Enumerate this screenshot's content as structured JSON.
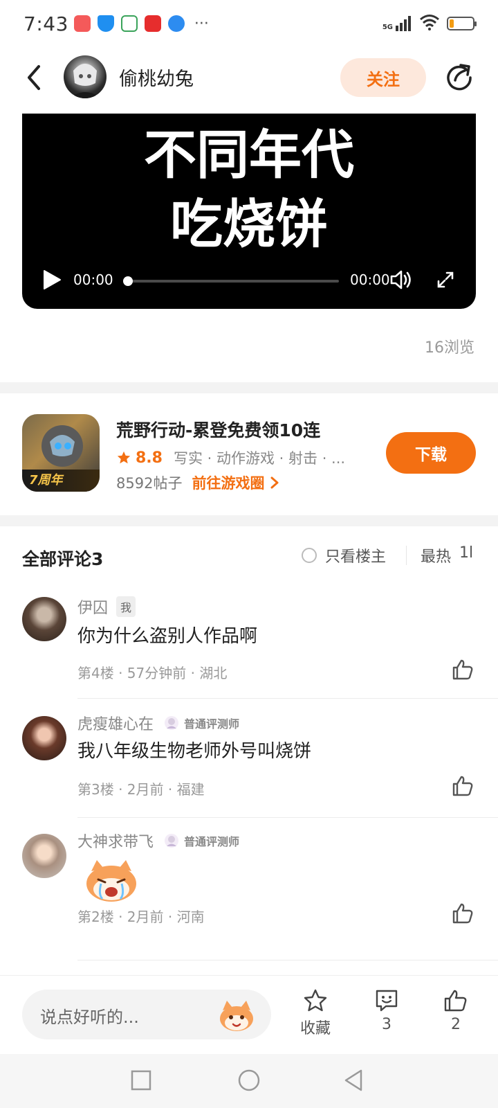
{
  "status_bar": {
    "time": "7:43",
    "more": "···",
    "network": "5G",
    "battery_level": 0.2,
    "battery_color": "#f39c12"
  },
  "header": {
    "author_name": "偷桃幼兔",
    "follow_label": "关注",
    "back_icon": "chevron-left-icon",
    "share_icon": "share-icon"
  },
  "video": {
    "title_line1": "不同年代",
    "title_line2": "吃烧饼",
    "current_time": "00:00",
    "total_time": "00:00",
    "progress": 0
  },
  "view_count": "16浏览",
  "game": {
    "title": "荒野行动-累登免费领10连",
    "rating": "8.8",
    "tags": "写实 · 动作游戏 · 射击 · ...",
    "posts": "8592帖子",
    "circle_link": "前往游戏圈",
    "download_label": "下载",
    "icon_badge": "7周年",
    "accent_color": "#f36f12"
  },
  "comments_header": {
    "title": "全部评论3",
    "only_op": "只看楼主",
    "sort": "最热",
    "sort_icon": "1l"
  },
  "comments": [
    {
      "user": "伊囚",
      "badge": "我",
      "text": "你为什么盗别人作品啊",
      "meta": "第4楼 · 57分钟前 · 湖北"
    },
    {
      "user": "虎瘦雄心在",
      "rank": "普通评测师",
      "text": "我八年级生物老师外号叫烧饼",
      "meta": "第3楼 · 2月前 · 福建"
    },
    {
      "user": "大神求带飞",
      "rank": "普通评测师",
      "sticker": "crying-mascot-sticker",
      "meta": "第2楼 · 2月前 · 河南"
    }
  ],
  "bottom_bar": {
    "input_placeholder": "说点好听的...",
    "favorite_label": "收藏",
    "comment_count": "3",
    "like_count": "2"
  }
}
